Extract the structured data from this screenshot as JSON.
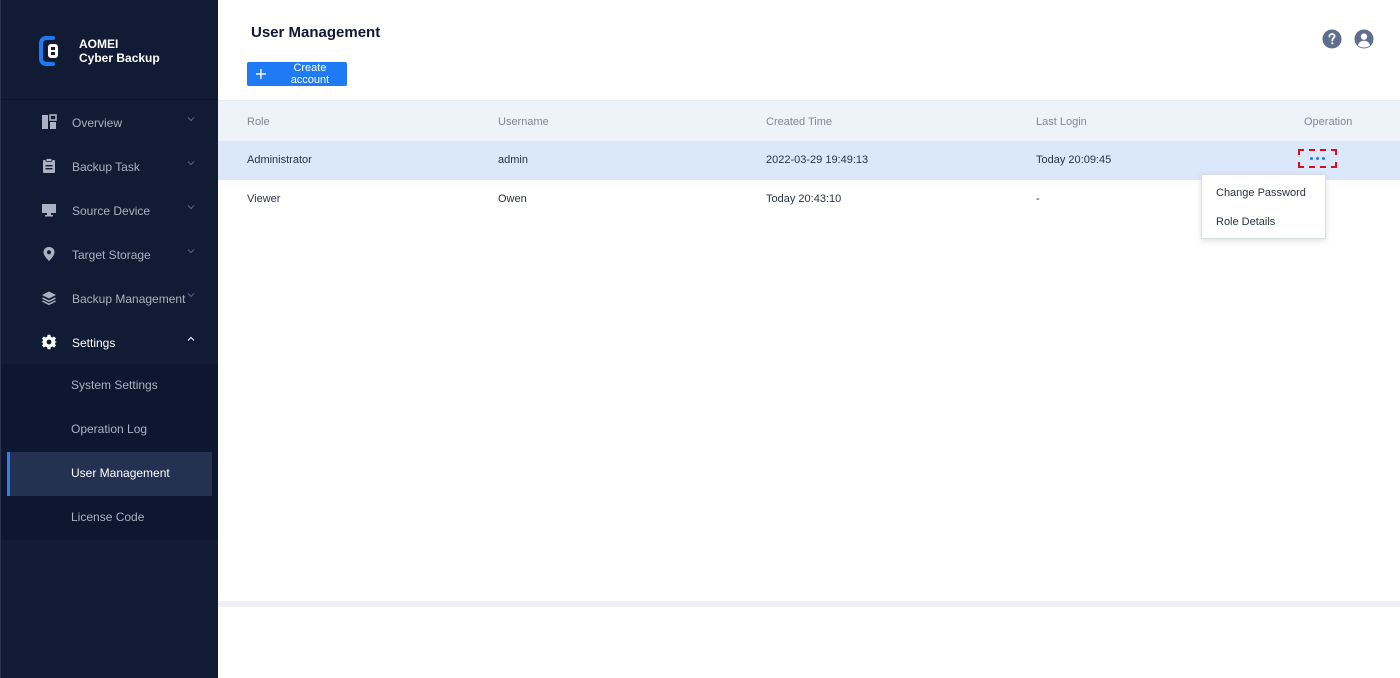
{
  "brand": {
    "line1": "AOMEI",
    "line2": "Cyber Backup"
  },
  "sidebar": {
    "items": [
      {
        "label": "Overview",
        "icon": "dashboard-icon"
      },
      {
        "label": "Backup Task",
        "icon": "clipboard-icon"
      },
      {
        "label": "Source Device",
        "icon": "monitor-icon"
      },
      {
        "label": "Target Storage",
        "icon": "location-pin-icon"
      },
      {
        "label": "Backup Management",
        "icon": "layers-icon"
      },
      {
        "label": "Settings",
        "icon": "gear-icon"
      }
    ],
    "subitems": [
      {
        "label": "System Settings"
      },
      {
        "label": "Operation Log"
      },
      {
        "label": "User Management"
      },
      {
        "label": "License Code"
      }
    ]
  },
  "main": {
    "title": "User Management",
    "create_button": "Create account"
  },
  "table": {
    "headers": [
      "Role",
      "Username",
      "Created Time",
      "Last Login",
      "Operation"
    ],
    "rows": [
      {
        "role": "Administrator",
        "username": "admin",
        "created": "2022-03-29 19:49:13",
        "last_login": "Today 20:09:45"
      },
      {
        "role": "Viewer",
        "username": "Owen",
        "created": "Today 20:43:10",
        "last_login": "-"
      }
    ]
  },
  "dropdown": {
    "items": [
      "Change Password",
      "Role Details"
    ]
  },
  "colors": {
    "sidebar_bg": "#111b33",
    "accent": "#1f7af5",
    "selected_row": "#dbe8fb",
    "highlight_border": "#d90d1b"
  }
}
